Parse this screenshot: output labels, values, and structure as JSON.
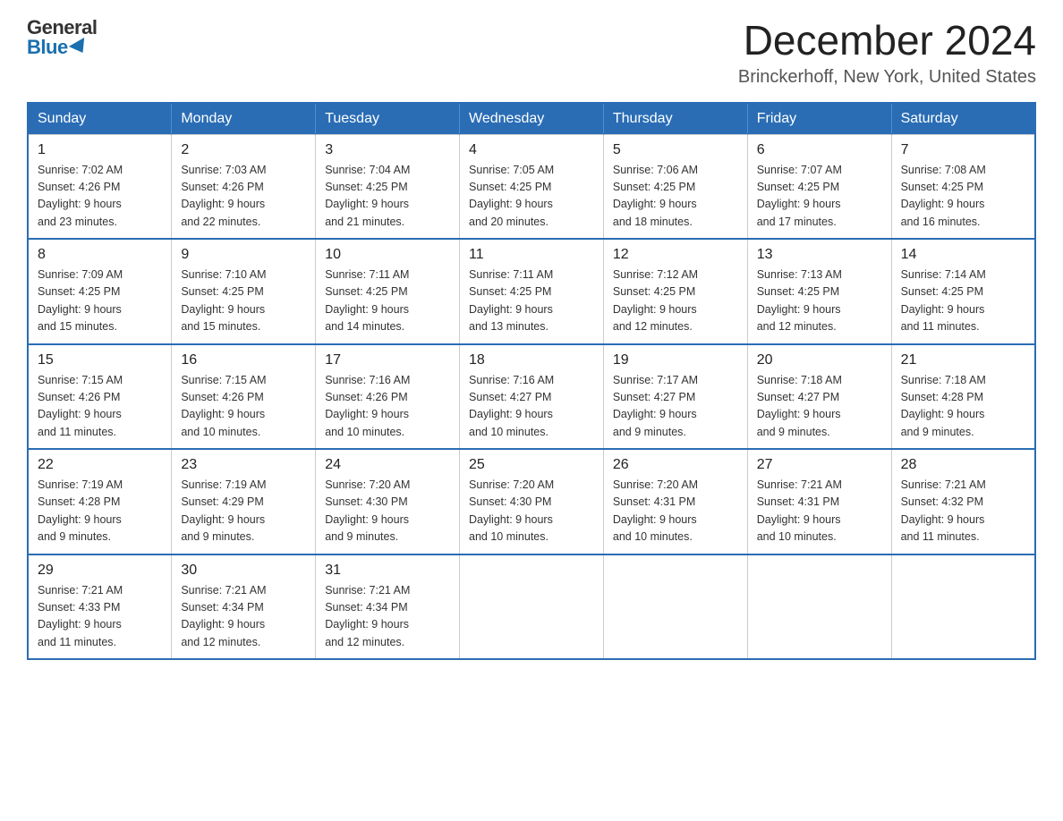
{
  "logo": {
    "general": "General",
    "blue": "Blue"
  },
  "title": "December 2024",
  "subtitle": "Brinckerhoff, New York, United States",
  "days_of_week": [
    "Sunday",
    "Monday",
    "Tuesday",
    "Wednesday",
    "Thursday",
    "Friday",
    "Saturday"
  ],
  "weeks": [
    [
      {
        "day": "1",
        "sunrise": "7:02 AM",
        "sunset": "4:26 PM",
        "daylight": "9 hours and 23 minutes."
      },
      {
        "day": "2",
        "sunrise": "7:03 AM",
        "sunset": "4:26 PM",
        "daylight": "9 hours and 22 minutes."
      },
      {
        "day": "3",
        "sunrise": "7:04 AM",
        "sunset": "4:25 PM",
        "daylight": "9 hours and 21 minutes."
      },
      {
        "day": "4",
        "sunrise": "7:05 AM",
        "sunset": "4:25 PM",
        "daylight": "9 hours and 20 minutes."
      },
      {
        "day": "5",
        "sunrise": "7:06 AM",
        "sunset": "4:25 PM",
        "daylight": "9 hours and 18 minutes."
      },
      {
        "day": "6",
        "sunrise": "7:07 AM",
        "sunset": "4:25 PM",
        "daylight": "9 hours and 17 minutes."
      },
      {
        "day": "7",
        "sunrise": "7:08 AM",
        "sunset": "4:25 PM",
        "daylight": "9 hours and 16 minutes."
      }
    ],
    [
      {
        "day": "8",
        "sunrise": "7:09 AM",
        "sunset": "4:25 PM",
        "daylight": "9 hours and 15 minutes."
      },
      {
        "day": "9",
        "sunrise": "7:10 AM",
        "sunset": "4:25 PM",
        "daylight": "9 hours and 15 minutes."
      },
      {
        "day": "10",
        "sunrise": "7:11 AM",
        "sunset": "4:25 PM",
        "daylight": "9 hours and 14 minutes."
      },
      {
        "day": "11",
        "sunrise": "7:11 AM",
        "sunset": "4:25 PM",
        "daylight": "9 hours and 13 minutes."
      },
      {
        "day": "12",
        "sunrise": "7:12 AM",
        "sunset": "4:25 PM",
        "daylight": "9 hours and 12 minutes."
      },
      {
        "day": "13",
        "sunrise": "7:13 AM",
        "sunset": "4:25 PM",
        "daylight": "9 hours and 12 minutes."
      },
      {
        "day": "14",
        "sunrise": "7:14 AM",
        "sunset": "4:25 PM",
        "daylight": "9 hours and 11 minutes."
      }
    ],
    [
      {
        "day": "15",
        "sunrise": "7:15 AM",
        "sunset": "4:26 PM",
        "daylight": "9 hours and 11 minutes."
      },
      {
        "day": "16",
        "sunrise": "7:15 AM",
        "sunset": "4:26 PM",
        "daylight": "9 hours and 10 minutes."
      },
      {
        "day": "17",
        "sunrise": "7:16 AM",
        "sunset": "4:26 PM",
        "daylight": "9 hours and 10 minutes."
      },
      {
        "day": "18",
        "sunrise": "7:16 AM",
        "sunset": "4:27 PM",
        "daylight": "9 hours and 10 minutes."
      },
      {
        "day": "19",
        "sunrise": "7:17 AM",
        "sunset": "4:27 PM",
        "daylight": "9 hours and 9 minutes."
      },
      {
        "day": "20",
        "sunrise": "7:18 AM",
        "sunset": "4:27 PM",
        "daylight": "9 hours and 9 minutes."
      },
      {
        "day": "21",
        "sunrise": "7:18 AM",
        "sunset": "4:28 PM",
        "daylight": "9 hours and 9 minutes."
      }
    ],
    [
      {
        "day": "22",
        "sunrise": "7:19 AM",
        "sunset": "4:28 PM",
        "daylight": "9 hours and 9 minutes."
      },
      {
        "day": "23",
        "sunrise": "7:19 AM",
        "sunset": "4:29 PM",
        "daylight": "9 hours and 9 minutes."
      },
      {
        "day": "24",
        "sunrise": "7:20 AM",
        "sunset": "4:30 PM",
        "daylight": "9 hours and 9 minutes."
      },
      {
        "day": "25",
        "sunrise": "7:20 AM",
        "sunset": "4:30 PM",
        "daylight": "9 hours and 10 minutes."
      },
      {
        "day": "26",
        "sunrise": "7:20 AM",
        "sunset": "4:31 PM",
        "daylight": "9 hours and 10 minutes."
      },
      {
        "day": "27",
        "sunrise": "7:21 AM",
        "sunset": "4:31 PM",
        "daylight": "9 hours and 10 minutes."
      },
      {
        "day": "28",
        "sunrise": "7:21 AM",
        "sunset": "4:32 PM",
        "daylight": "9 hours and 11 minutes."
      }
    ],
    [
      {
        "day": "29",
        "sunrise": "7:21 AM",
        "sunset": "4:33 PM",
        "daylight": "9 hours and 11 minutes."
      },
      {
        "day": "30",
        "sunrise": "7:21 AM",
        "sunset": "4:34 PM",
        "daylight": "9 hours and 12 minutes."
      },
      {
        "day": "31",
        "sunrise": "7:21 AM",
        "sunset": "4:34 PM",
        "daylight": "9 hours and 12 minutes."
      },
      null,
      null,
      null,
      null
    ]
  ]
}
